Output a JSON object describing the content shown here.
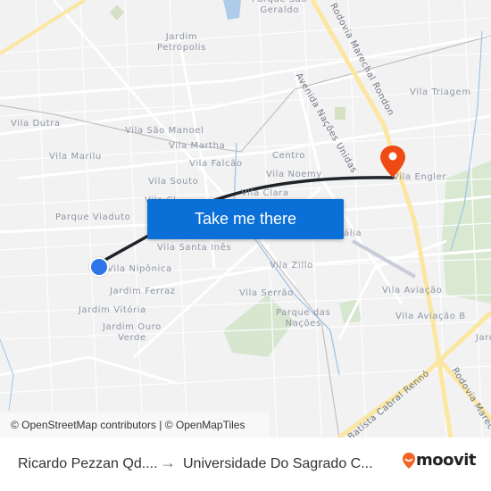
{
  "map": {
    "labels": [
      {
        "text": "Jardim\nPetrópolis"
      },
      {
        "text": "Parque São\nGeraldo"
      },
      {
        "text": "Vila Dutra"
      },
      {
        "text": "Vila São Manoel"
      },
      {
        "text": "Vila Martha"
      },
      {
        "text": "Vila Marilu"
      },
      {
        "text": "Vila Falcão"
      },
      {
        "text": "Centro"
      },
      {
        "text": "Vila Noemy"
      },
      {
        "text": "Vila Souto"
      },
      {
        "text": "Vila Clara"
      },
      {
        "text": "Parque Viaduto"
      },
      {
        "text": "Vila Santa Inês"
      },
      {
        "text": "Vila Nipônica"
      },
      {
        "text": "Jardim Ferraz"
      },
      {
        "text": "Jardim Vitória"
      },
      {
        "text": "Jardim Ouro\nVerde"
      },
      {
        "text": "Vila Triagem"
      },
      {
        "text": "Vila Engler"
      },
      {
        "text": "Vila Zillo"
      },
      {
        "text": "Vila Serrão"
      },
      {
        "text": "Parque das\nNações"
      },
      {
        "text": "Vila Aviação"
      },
      {
        "text": "Vila Aviação B"
      },
      {
        "text": "Jard"
      },
      {
        "text": "Vila Cl"
      },
      {
        "text": "ália"
      }
    ],
    "roads": [
      {
        "text": "Rodovia Marechal Rondon"
      },
      {
        "text": "Avenida Nações Unidas"
      },
      {
        "text": "Batista Cabral Rennó"
      },
      {
        "text": "Rodovia Marec"
      }
    ],
    "origin_marker": "origin-dot",
    "destination_marker": "destination-pin"
  },
  "cta": {
    "label": "Take me there"
  },
  "attribution": {
    "text": "© OpenStreetMap contributors | © OpenMapTiles"
  },
  "footer": {
    "from": "Ricardo Pezzan Qd....",
    "arrow": "→",
    "to": "Universidade Do Sagrado C...",
    "brand": "moovit",
    "brand_color": "#f26522"
  },
  "colors": {
    "route": "#1f2328",
    "cta": "#0a6fd6",
    "origin": "#2e75e8",
    "destination": "#f04a14",
    "highway": "#fbe7a1"
  }
}
